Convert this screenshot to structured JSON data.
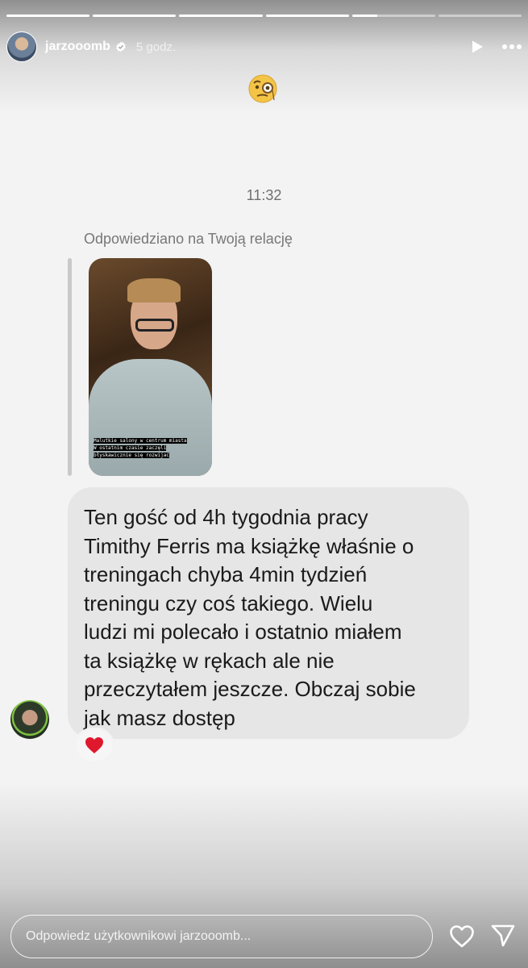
{
  "header": {
    "username": "jarzooomb",
    "time_ago": "5 godz."
  },
  "progress": {
    "segments_total": 6,
    "segment_fill": [
      1,
      1,
      1,
      1,
      0.3,
      0
    ]
  },
  "message": {
    "timestamp": "11:32",
    "replied_label": "Odpowiedziano na Twoją relację",
    "story_caption": [
      "Malutkie salony w centrum miasta",
      "W ostatnim czasie zaczęli",
      "błyskawicznie się rozwijać"
    ],
    "text_lines": [
      "Ten gość od 4h tygodnia pracy",
      "Timithy Ferris ma książkę właśnie o",
      "treningach chyba 4min tydzień",
      "treningu czy coś takiego. Wielu",
      "ludzi mi polecało i ostatnio miałem",
      "ta książkę w rękach ale nie",
      "przeczytałem jeszcze. Obczaj sobie",
      "jak masz dostęp"
    ],
    "reaction": "❤️"
  },
  "footer": {
    "reply_placeholder": "Odpowiedz użytkownikowi jarzooomb..."
  },
  "colors": {
    "bubble": "#e6e6e6",
    "heart": "#e0182d",
    "verified": "#ffffff"
  },
  "icons": [
    "play-icon",
    "more-icon",
    "verified-icon",
    "monocle-emoji-icon",
    "heart-icon",
    "send-icon"
  ]
}
